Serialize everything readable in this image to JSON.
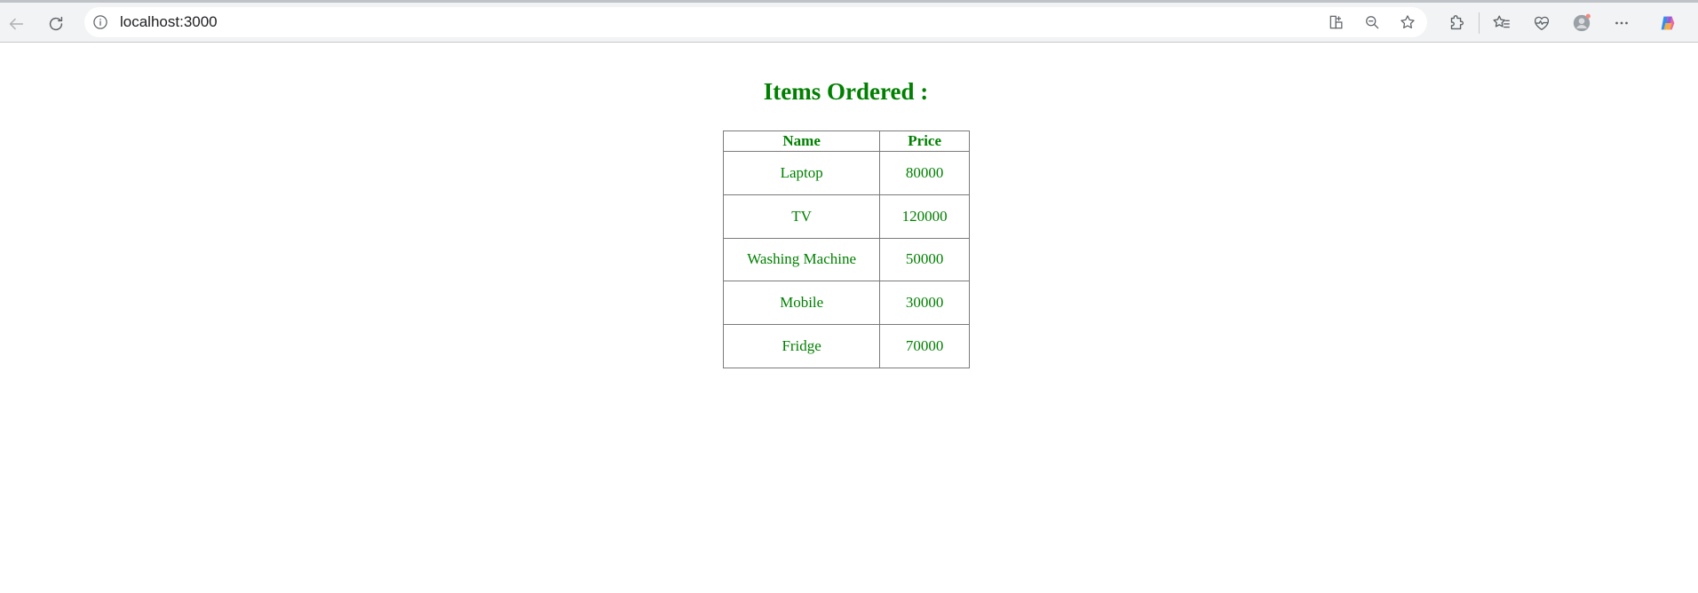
{
  "browser": {
    "url": "localhost:3000",
    "icons": {
      "back": "back-arrow-icon",
      "reload": "reload-icon",
      "info": "info-icon",
      "app_available": "app-available-icon",
      "zoom": "zoom-out-icon",
      "favorite": "star-icon",
      "extensions": "extensions-icon",
      "favorites": "favorites-icon",
      "health": "browser-essentials-icon",
      "profile": "profile-avatar-icon",
      "menu": "more-menu-icon",
      "copilot": "copilot-icon"
    }
  },
  "page": {
    "heading": "Items Ordered :",
    "table": {
      "headers": [
        "Name",
        "Price"
      ],
      "rows": [
        [
          "Laptop",
          "80000"
        ],
        [
          "TV",
          "120000"
        ],
        [
          "Washing Machine",
          "50000"
        ],
        [
          "Mobile",
          "30000"
        ],
        [
          "Fridge",
          "70000"
        ]
      ]
    }
  },
  "colors": {
    "text_green": "#008000",
    "border": "#7a7a7a",
    "toolbar": "#f1f3f4"
  }
}
